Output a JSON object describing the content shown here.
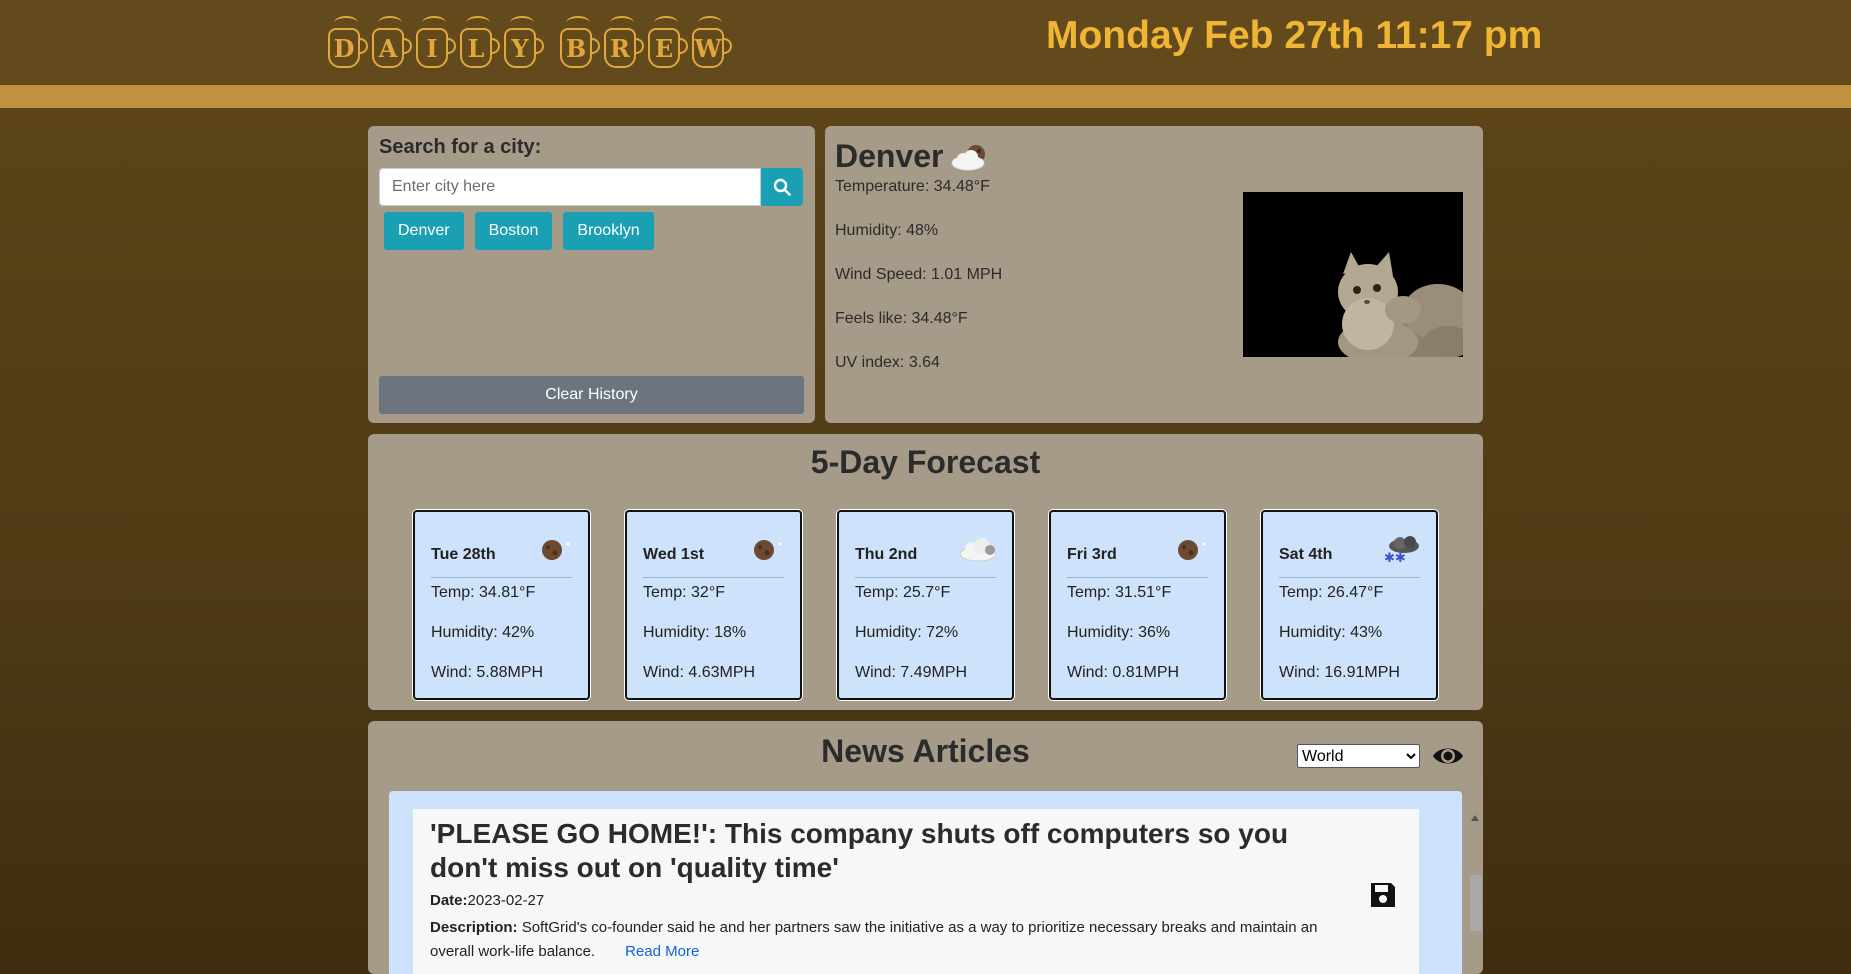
{
  "header": {
    "logo_letters": [
      "D",
      "A",
      "I",
      "L",
      "Y",
      "B",
      "R",
      "E",
      "W"
    ],
    "datetime": "Monday Feb 27th 11:17 pm"
  },
  "search": {
    "title": "Search for a city:",
    "placeholder": "Enter city here",
    "button_icon": "search-icon",
    "history": [
      "Denver",
      "Boston",
      "Brooklyn"
    ],
    "clear_label": "Clear History"
  },
  "current": {
    "city": "Denver",
    "icon": "cloud-with-moon-icon",
    "temperature": "Temperature: 34.48°F",
    "humidity": "Humidity: 48%",
    "wind": "Wind Speed: 1.01 MPH",
    "feels_like": "Feels like: 34.48°F",
    "uv": "UV index: 3.64",
    "image": "cat-in-clouds-photo"
  },
  "forecast": {
    "title": "5-Day Forecast",
    "days": [
      {
        "day": "Tue 28th",
        "icon": "moon-icon",
        "temp": "Temp: 34.81°F",
        "humidity": "Humidity: 42%",
        "wind": "Wind: 5.88MPH"
      },
      {
        "day": "Wed 1st",
        "icon": "moon-icon",
        "temp": "Temp: 32°F",
        "humidity": "Humidity: 18%",
        "wind": "Wind: 4.63MPH"
      },
      {
        "day": "Thu 2nd",
        "icon": "cloud-icon",
        "temp": "Temp: 25.7°F",
        "humidity": "Humidity: 72%",
        "wind": "Wind: 7.49MPH"
      },
      {
        "day": "Fri 3rd",
        "icon": "moon-icon",
        "temp": "Temp: 31.51°F",
        "humidity": "Humidity: 36%",
        "wind": "Wind: 0.81MPH"
      },
      {
        "day": "Sat 4th",
        "icon": "snow-icon",
        "temp": "Temp: 26.47°F",
        "humidity": "Humidity: 43%",
        "wind": "Wind: 16.91MPH"
      }
    ]
  },
  "news": {
    "title": "News Articles",
    "category_selected": "World",
    "article": {
      "title": "'PLEASE GO HOME!': This company shuts off computers so you don't miss out on 'quality time'",
      "date_label": "Date:",
      "date": "2023-02-27",
      "desc_label": "Description:",
      "description": "SoftGrid's co-founder said he and her partners saw the initiative as a way to prioritize necessary breaks and maintain an overall work-life balance.",
      "read_more": "Read More"
    }
  },
  "colors": {
    "header_bg": "#624a1c",
    "stripe": "#c2913f",
    "accent_text": "#f0b532",
    "panel_bg": "#a69a89",
    "button_teal": "#1b9fb3",
    "card_bg": "#cfe2fb"
  }
}
